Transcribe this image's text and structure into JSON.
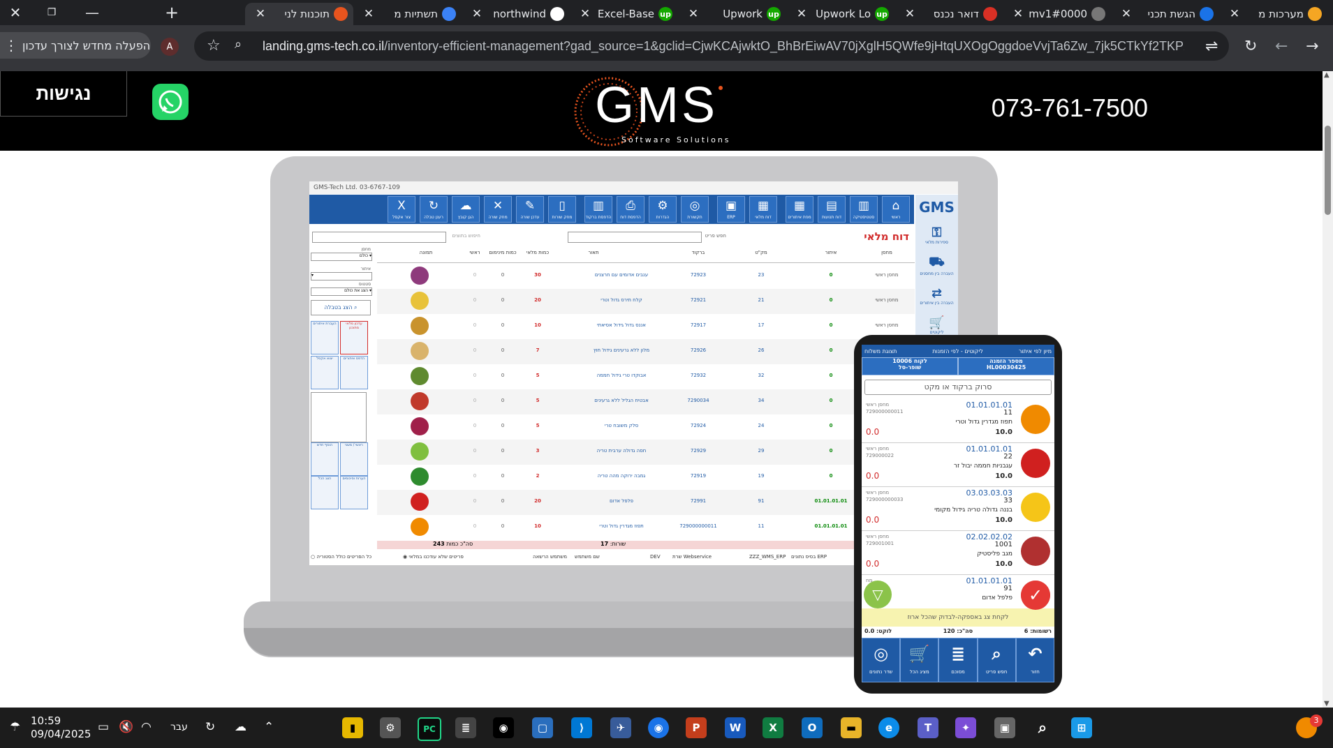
{
  "browser": {
    "tabs": [
      {
        "title": "מערכות מ",
        "fav": "orange"
      },
      {
        "title": "הגשת תכני",
        "fav": "blue"
      },
      {
        "title": "mv1#0000",
        "fav": "gray"
      },
      {
        "title": "דואר נכנס",
        "fav": "gmail"
      },
      {
        "title": "Upwork Lo",
        "fav": "up"
      },
      {
        "title": "Upwork",
        "fav": "up"
      },
      {
        "title": "Excel-Base",
        "fav": "up"
      },
      {
        "title": "northwind",
        "fav": "github"
      },
      {
        "title": "תשתיות מ",
        "fav": "stack"
      },
      {
        "title": "תוכנות לני",
        "fav": "check",
        "active": true
      }
    ],
    "relaunch_label": "הפעלה מחדש לצורך עדכון",
    "avatar_letter": "A",
    "url_host": "landing.gms-tech.co.il",
    "url_path": "/inventory-efficient-management?gad_source=1&gclid=CjwKCAjwktO_BhBrEiwAV70jXglH5QWfe9jHtqUXOgOggdoeVvjTa6Zw_7jk5CTkYf2TKP21Wx3A..."
  },
  "page": {
    "accessibility_label": "נגישות",
    "logo_text": "GMS",
    "logo_sub": "Software Solutions",
    "phone": "073-761-7500"
  },
  "desktop_app": {
    "window_title": "GMS-Tech Ltd.  03-6767-109",
    "screen_title": "דוח מלאי",
    "search_placeholder": "חיפוש בתוצים",
    "search_item_label": "חפש פריט",
    "ribbon": [
      {
        "label": "ראשי",
        "icon": "home-icon",
        "glyph": "⌂"
      },
      {
        "label": "סטטיסטיקה",
        "icon": "chart-icon",
        "glyph": "▥"
      },
      {
        "label": "דוח תנועות",
        "icon": "report-icon",
        "glyph": "▤"
      },
      {
        "label": "מפת איתורים",
        "icon": "grid-icon",
        "glyph": "▦"
      },
      {
        "label": "דוח מלאי",
        "icon": "table-icon",
        "glyph": "▦"
      },
      {
        "label": "ERP",
        "icon": "erp-icon",
        "glyph": "▣"
      },
      {
        "label": "תקשורת",
        "icon": "antenna-icon",
        "glyph": "◎"
      },
      {
        "label": "הגדרות",
        "icon": "settings-icon",
        "glyph": "⚙"
      },
      {
        "label": "הדפסת דוח",
        "icon": "print-icon",
        "glyph": "⎙"
      },
      {
        "label": "הדפסת ברקוד",
        "icon": "barcode-icon",
        "glyph": "▥"
      },
      {
        "label": "מחק שורות",
        "icon": "trash-icon",
        "glyph": "▯"
      },
      {
        "label": "עדכן שורה",
        "icon": "edit-icon",
        "glyph": "✎"
      },
      {
        "label": "מחק שורה",
        "icon": "close-icon",
        "glyph": "✕"
      },
      {
        "label": "הגן קובץ",
        "icon": "cloud-icon",
        "glyph": "☁"
      },
      {
        "label": "רענן טבלה",
        "icon": "refresh-icon",
        "glyph": "↻"
      },
      {
        "label": "צור אקסל",
        "icon": "excel-icon",
        "glyph": "X"
      }
    ],
    "side_items": [
      {
        "label": "ספירות מלאי",
        "icon": "count-icon"
      },
      {
        "label": "העברה בין מחסנים",
        "icon": "transfer-icon"
      },
      {
        "label": "העברה בין איתורים",
        "icon": "move-icon"
      },
      {
        "label": "ליקוטים",
        "icon": "cart-icon"
      }
    ],
    "columns": [
      "מחסן",
      "איתור",
      "מק\"ט",
      "ברקוד",
      "תאור",
      "כמות מלאי",
      "כמות מינימום",
      "ראשי",
      "תמונה"
    ],
    "rows": [
      {
        "warehouse": "מחסן ראשי",
        "location": "0",
        "sku": "23",
        "barcode": "72923",
        "desc": "ענבים אדומים עם חרצנים",
        "qty": "30",
        "min": "0",
        "main": "0",
        "img": "#8e3a7c"
      },
      {
        "warehouse": "מחסן ראשי",
        "location": "0",
        "sku": "21",
        "barcode": "72921",
        "desc": "קלח תירס גדול וטרי",
        "qty": "20",
        "min": "0",
        "main": "0",
        "img": "#e8c23a"
      },
      {
        "warehouse": "מחסן ראשי",
        "location": "0",
        "sku": "17",
        "barcode": "72917",
        "desc": "אננס גדול גידול אסיאתי",
        "qty": "10",
        "min": "0",
        "main": "0",
        "img": "#c9932d"
      },
      {
        "warehouse": "מחסן ראשי",
        "location": "0",
        "sku": "26",
        "barcode": "72926",
        "desc": "מלון ללא גרעינים גידול חוץ",
        "qty": "7",
        "min": "0",
        "main": "0",
        "img": "#d9b36b"
      },
      {
        "warehouse": "מחסן ראשי",
        "location": "0",
        "sku": "32",
        "barcode": "72932",
        "desc": "אבוקדו טרי גידול חממה",
        "qty": "5",
        "min": "0",
        "main": "0",
        "img": "#5f8a2f"
      },
      {
        "warehouse": "מחסן ראשי",
        "location": "0",
        "sku": "34",
        "barcode": "7290034",
        "desc": "אבטיח הגליל ללא גרעינים",
        "qty": "5",
        "min": "0",
        "main": "0",
        "img": "#c0392b"
      },
      {
        "warehouse": "מחסן ראשי",
        "location": "0",
        "sku": "24",
        "barcode": "72924",
        "desc": "סלק משובח טרי",
        "qty": "5",
        "min": "0",
        "main": "0",
        "img": "#a0204a"
      },
      {
        "warehouse": "מחסן ראשי",
        "location": "0",
        "sku": "29",
        "barcode": "72929",
        "desc": "חסה גדולה ערבית טריה",
        "qty": "3",
        "min": "0",
        "main": "0",
        "img": "#7fbf3f"
      },
      {
        "warehouse": "מחסן ראשי",
        "location": "0",
        "sku": "19",
        "barcode": "72919",
        "desc": "גמבה ירוקה מהה טריה",
        "qty": "2",
        "min": "0",
        "main": "0",
        "img": "#2e8b2e"
      },
      {
        "warehouse": "מחסן ראשי",
        "location": "01.01.01.01",
        "sku": "91",
        "barcode": "72991",
        "desc": "פלפל אדום",
        "qty": "20",
        "min": "0",
        "main": "0",
        "img": "#d0201f"
      },
      {
        "warehouse": "מחסן ראשי",
        "location": "01.01.01.01",
        "sku": "11",
        "barcode": "729000000011",
        "desc": "תפוז מגדרין גדול וטרי",
        "qty": "10",
        "min": "0",
        "main": "0",
        "img": "#f08a00"
      }
    ],
    "left_panel": {
      "warehouse_label": "מחסן",
      "warehouse_value": "כולם",
      "location_label": "איתור",
      "status_label": "סטטוס",
      "status_value": "הצג את כולם",
      "show_table_btn": "הצג בטבלה",
      "buttons": [
        "עדכון מלאי מתוכנן",
        "העברת איתורים",
        "הדפס איתורים",
        "יצוא אקסל",
        "ראשי / משני",
        "הוסף חדש",
        "הערות וסיכומים",
        "הצג הכל"
      ]
    },
    "totals": {
      "rows_label": "שורות:",
      "rows_value": "17",
      "qty_label": "סה\"כ כמות",
      "qty_value": "243"
    },
    "status": {
      "db": "בסיס נתונים  ERP",
      "schema": "ZZZ_WMS_ERP",
      "server": "שרת  Webservice",
      "env": "DEV",
      "user": "שם משתמש",
      "perm": "משתמש הרשאה",
      "radio1": "פריטים שלא עודכנו במלאי",
      "radio2": "כל הפריטים כולל הסטוריה"
    }
  },
  "mobile_app": {
    "header_left": "תצוגת משלוח",
    "header_mid": "ליקוטים - לפי הזמנות",
    "header_right": "מיון לפי איתור",
    "order_label": "מספר הזמנה",
    "order_value": "HL00030425",
    "customer_label": "לקוח 10006",
    "customer_value": "שופר-סל",
    "scan_placeholder": "סרוק ברקוד או מקט",
    "items": [
      {
        "loc": "01.01.01.01",
        "wh": "מחסן ראשי",
        "barcode": "729000000011",
        "code": "11",
        "name": "תפוז מגדרין גדול וטרי",
        "qty": "10.0",
        "picked": "0.0",
        "img": "#f08a00"
      },
      {
        "loc": "01.01.01.01",
        "wh": "מחסן ראשי",
        "barcode": "729000022",
        "code": "22",
        "name": "עגבניות חממה יבול זר",
        "qty": "10.0",
        "picked": "0.0",
        "img": "#d0201f"
      },
      {
        "loc": "03.03.03.03",
        "wh": "מחסן ראשי",
        "barcode": "729000000033",
        "code": "33",
        "name": "בננה גדולה טריה גידול מקומי",
        "qty": "10.0",
        "picked": "0.0",
        "img": "#f5c518"
      },
      {
        "loc": "02.02.02.02",
        "wh": "מחסן ראשי",
        "barcode": "729001001",
        "code": "1001",
        "name": "מגב פליסטיק",
        "qty": "10.0",
        "picked": "0.0",
        "img": "#b03030"
      },
      {
        "loc": "01.01.01.01",
        "wh": "מח",
        "barcode": "",
        "code": "91",
        "name": "פלפל אדום",
        "qty": "",
        "picked": "",
        "img": "#d0201f"
      }
    ],
    "note": "לקחת צג באספקה-לבדוק שהכל ארוז",
    "stat_records": "רשומות: 6",
    "stat_total": "סה\"כ: 120",
    "stat_picked": "לוקט: 0.0",
    "bottom": [
      "חזור",
      "חפש פריט",
      "מסוכם",
      "מציג הכל",
      "שדר נתונים"
    ]
  },
  "taskbar": {
    "time": "10:59",
    "date": "09/04/2025",
    "lang": "עבר",
    "notif_count": "3"
  }
}
